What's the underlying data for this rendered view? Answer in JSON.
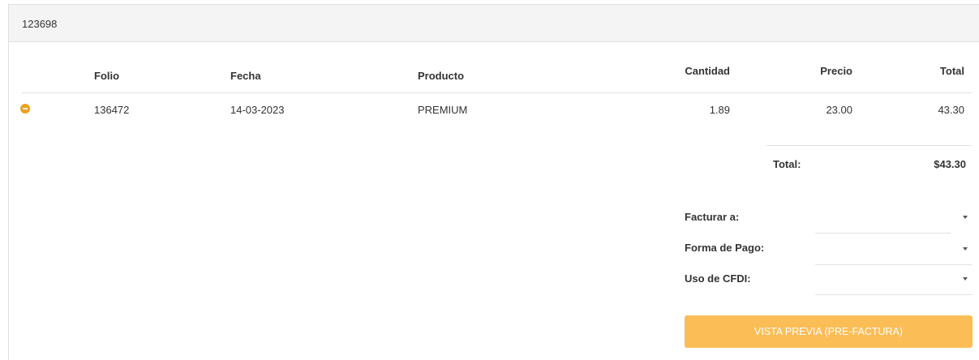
{
  "header": {
    "code": "123698"
  },
  "table": {
    "columns": {
      "folio": "Folio",
      "fecha": "Fecha",
      "producto": "Producto",
      "cantidad": "Cantidad",
      "precio": "Precio",
      "total": "Total"
    },
    "rows": [
      {
        "folio": "136472",
        "fecha": "14-03-2023",
        "producto": "PREMIUM",
        "cantidad": "1.89",
        "precio": "23.00",
        "total": "43.30",
        "remove_icon": "minus-circle-icon"
      }
    ]
  },
  "summary": {
    "total_label": "Total:",
    "total_value": "$43.30"
  },
  "form": {
    "facturar_label": "Facturar a:",
    "facturar_value": "",
    "forma_pago_label": "Forma de Pago:",
    "forma_pago_value": "",
    "uso_cfdi_label": "Uso de CFDI:",
    "uso_cfdi_value": "",
    "caret_icon": "caret-down-icon"
  },
  "actions": {
    "preview_label": "VISTA PREVIA (PRE-FACTURA)"
  },
  "colors": {
    "accent": "#fbbd56",
    "remove_icon": "#f0a020"
  }
}
